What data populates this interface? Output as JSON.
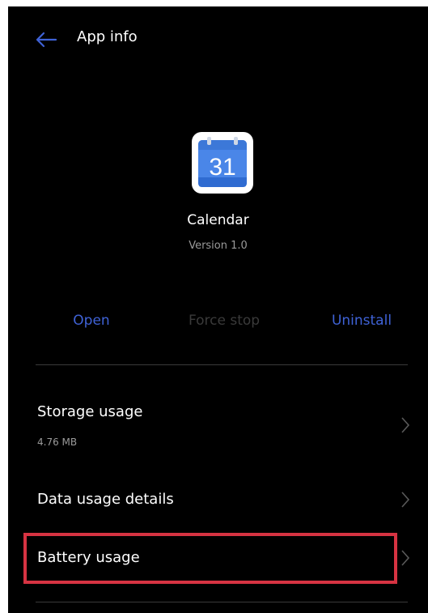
{
  "header": {
    "title": "App info",
    "back_icon": "arrow-left-icon"
  },
  "app": {
    "name": "Calendar",
    "version": "Version 1.0",
    "icon_day": "31",
    "icon": "calendar-app-icon"
  },
  "actions": {
    "open": "Open",
    "force_stop": "Force stop",
    "uninstall": "Uninstall"
  },
  "rows": {
    "storage": {
      "label": "Storage usage",
      "value": "4.76 MB"
    },
    "data": {
      "label": "Data usage details"
    },
    "battery": {
      "label": "Battery usage"
    }
  },
  "colors": {
    "background": "#000000",
    "accent": "#3f62d6",
    "disabled": "#3a3a3a",
    "highlight": "#d63342"
  }
}
